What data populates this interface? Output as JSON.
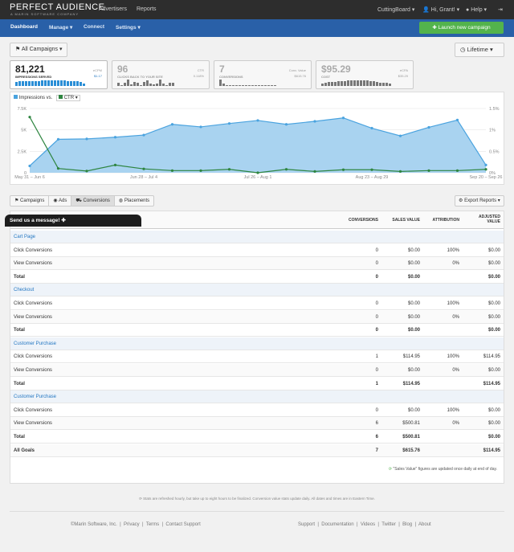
{
  "topbar": {
    "logo": "PERFECT AUDIENCE",
    "logo_sub": "A MARIN SOFTWARE COMPANY",
    "nav": [
      "Advertisers",
      "Reports"
    ],
    "account": "CuttingBoard",
    "user": "Hi, Grant!",
    "help": "Help"
  },
  "subnav": {
    "items": [
      "Dashboard",
      "Manage",
      "Connect",
      "Settings"
    ],
    "launch": "Launch new campaign"
  },
  "filters": {
    "campaigns": "All Campaigns",
    "range": "Lifetime"
  },
  "stats": [
    {
      "value": "81,221",
      "label": "IMPRESSIONS SERVED",
      "right_label": "eCPM",
      "right_value": "$1.17",
      "bars": [
        5,
        6,
        6,
        6,
        6,
        6,
        6,
        6,
        7,
        7,
        7,
        7,
        7,
        7,
        7,
        7,
        6,
        6,
        6,
        6,
        5,
        3
      ]
    },
    {
      "value": "96",
      "label": "CLICKS BACK TO YOUR SITE",
      "right_label": "CTR",
      "right_value": "0.118%",
      "bars": [
        4,
        1,
        4,
        8,
        2,
        5,
        4,
        1,
        5,
        7,
        3,
        2,
        3,
        8,
        3,
        1,
        4,
        4
      ]
    },
    {
      "value": "7",
      "label": "CONVERSIONS",
      "right_label": "Conv. Value",
      "right_value": "$615.76",
      "bars": [
        8,
        3,
        1,
        1,
        1,
        1,
        1,
        1,
        1,
        1,
        1,
        1,
        1,
        1,
        1,
        1,
        1,
        1
      ]
    },
    {
      "value": "$95.29",
      "label": "COST",
      "right_label": "eCPA",
      "right_value": "$35.29",
      "bars": [
        3,
        4,
        5,
        5,
        5,
        6,
        6,
        6,
        7,
        7,
        7,
        7,
        7,
        7,
        7,
        6,
        6,
        5,
        4,
        4,
        4,
        3
      ]
    }
  ],
  "chart_data": {
    "type": "area",
    "legend": [
      "Impressions vs.",
      "CTR"
    ],
    "x_ticks": [
      "May 31 – Jun 6",
      "Jun 28 – Jul 4",
      "Jul 26 – Aug 1",
      "Aug 23 – Aug 29",
      "Sep 20 – Sep 26"
    ],
    "y_left_ticks": [
      "7.5K",
      "5K",
      "2.5K",
      "0"
    ],
    "y_right_ticks": [
      "1.5%",
      "1%",
      "0.5%",
      "0%"
    ],
    "ylim_left": [
      0,
      7500
    ],
    "ylim_right": [
      0,
      1.5
    ],
    "series": [
      {
        "name": "Impressions",
        "color": "#4aa3df",
        "values": [
          800,
          3900,
          3950,
          4150,
          4400,
          5650,
          5350,
          5750,
          6100,
          5650,
          6000,
          6400,
          5200,
          4300,
          5300,
          6150,
          900
        ]
      },
      {
        "name": "CTR",
        "color": "#2e8540",
        "values": [
          1.3,
          0.1,
          0.04,
          0.18,
          0.09,
          0.05,
          0.05,
          0.08,
          0.0,
          0.08,
          0.03,
          0.07,
          0.07,
          0.03,
          0.05,
          0.05,
          0.08
        ]
      }
    ]
  },
  "tabs": [
    "Campaigns",
    "Ads",
    "Conversions",
    "Placements"
  ],
  "export": "Export Reports",
  "send_message": "Send us a message!",
  "table": {
    "headers": [
      "CONVERSIONS",
      "SALES VALUE",
      "ATTRIBUTION",
      "ADJUSTED VALUE"
    ],
    "groups": [
      {
        "name": "Cart Page",
        "rows": [
          [
            "Click Conversions",
            "0",
            "$0.00",
            "100%",
            "$0.00"
          ],
          [
            "View Conversions",
            "0",
            "$0.00",
            "0%",
            "$0.00"
          ],
          [
            "Total",
            "0",
            "$0.00",
            "",
            "$0.00"
          ]
        ]
      },
      {
        "name": "Checkout",
        "rows": [
          [
            "Click Conversions",
            "0",
            "$0.00",
            "100%",
            "$0.00"
          ],
          [
            "View Conversions",
            "0",
            "$0.00",
            "0%",
            "$0.00"
          ],
          [
            "Total",
            "0",
            "$0.00",
            "",
            "$0.00"
          ]
        ]
      },
      {
        "name": "Customer Purchase",
        "rows": [
          [
            "Click Conversions",
            "1",
            "$114.95",
            "100%",
            "$114.95"
          ],
          [
            "View Conversions",
            "0",
            "$0.00",
            "0%",
            "$0.00"
          ],
          [
            "Total",
            "1",
            "$114.95",
            "",
            "$114.95"
          ]
        ]
      },
      {
        "name": "Customer Purchase",
        "rows": [
          [
            "Click Conversions",
            "0",
            "$0.00",
            "100%",
            "$0.00"
          ],
          [
            "View Conversions",
            "6",
            "$500.81",
            "0%",
            "$0.00"
          ],
          [
            "Total",
            "6",
            "$500.81",
            "",
            "$0.00"
          ]
        ]
      }
    ],
    "all_goals": [
      "All Goals",
      "7",
      "$615.76",
      "",
      "$114.95"
    ],
    "note": "\"Sales Value\" figures are updated once daily at end of day."
  },
  "stats_note": "Stats are refreshed hourly, but take up to eight hours to be finalized. Conversion value stats update daily. All dates and times are in Eastern Time.",
  "footer": {
    "left": [
      "©Marin Software, Inc.",
      "Privacy",
      "Terms",
      "Contact Support"
    ],
    "right": [
      "Support",
      "Documentation",
      "Videos",
      "Twitter",
      "Blog",
      "About"
    ]
  }
}
